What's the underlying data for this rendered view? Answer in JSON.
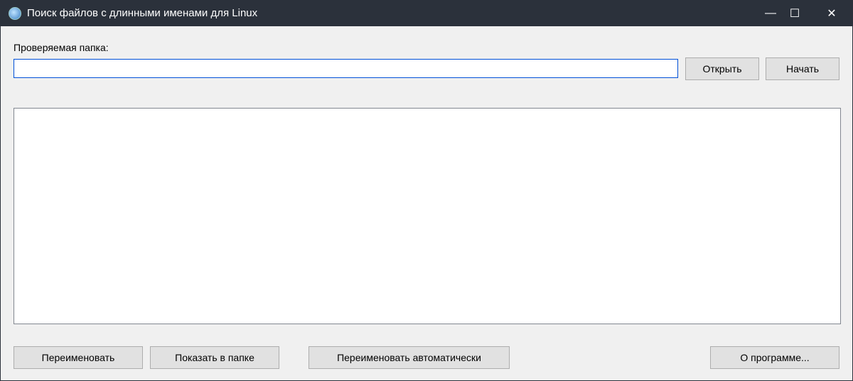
{
  "window": {
    "title": "Поиск файлов с длинными именами для Linux",
    "minimize": "—",
    "maximize": "☐",
    "close": "✕"
  },
  "folder": {
    "label": "Проверяемая папка:",
    "value": "",
    "open_button": "Открыть",
    "start_button": "Начать"
  },
  "results": [],
  "actions": {
    "rename": "Переименовать",
    "show_in_folder": "Показать в папке",
    "rename_auto": "Переименовать автоматически",
    "about": "О программе..."
  }
}
